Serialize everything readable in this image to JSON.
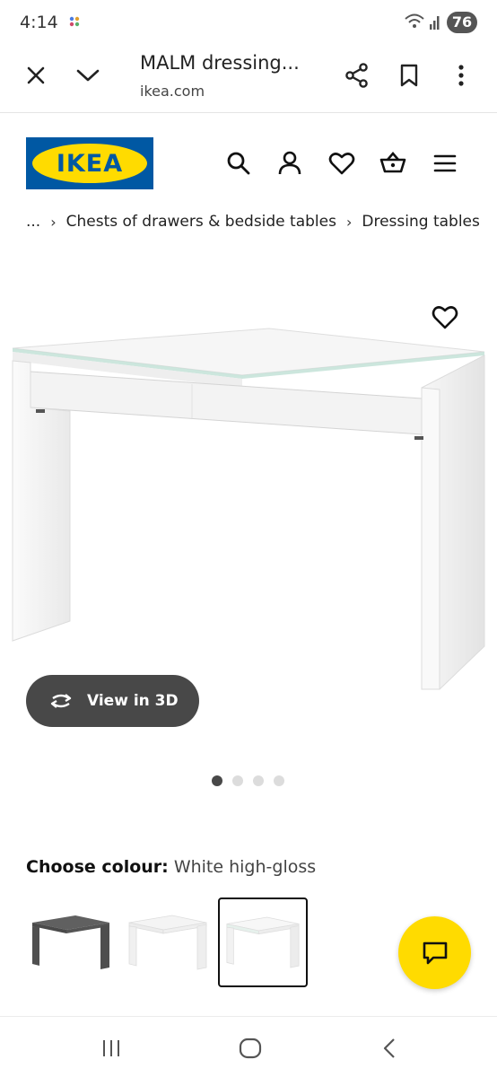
{
  "status_bar": {
    "time": "4:14",
    "battery": "76"
  },
  "browser": {
    "title": "MALM dressing...",
    "url": "ikea.com"
  },
  "header": {
    "logo_text": "IKEA",
    "brand_blue": "#0058a3",
    "brand_yellow": "#ffdb00"
  },
  "breadcrumb": {
    "ellipsis": "...",
    "separator": "›",
    "items": [
      "Chests of drawers & bedside tables",
      "Dressing tables"
    ]
  },
  "product": {
    "view_3d_label": "View in 3D",
    "image_count": 4,
    "active_image": 1
  },
  "colour": {
    "label": "Choose colour:",
    "value": "White high-gloss",
    "swatches": [
      "Black-brown",
      "White",
      "White high-gloss"
    ],
    "selected_swatch": 3
  },
  "icons": {
    "toolbar": [
      "close-icon",
      "chevron-down-icon",
      "share-icon",
      "bookmark-icon",
      "more-icon"
    ],
    "header": [
      "search-icon",
      "account-icon",
      "heart-icon",
      "basket-icon",
      "menu-icon"
    ],
    "nav": [
      "recents-icon",
      "home-icon",
      "back-icon"
    ]
  }
}
